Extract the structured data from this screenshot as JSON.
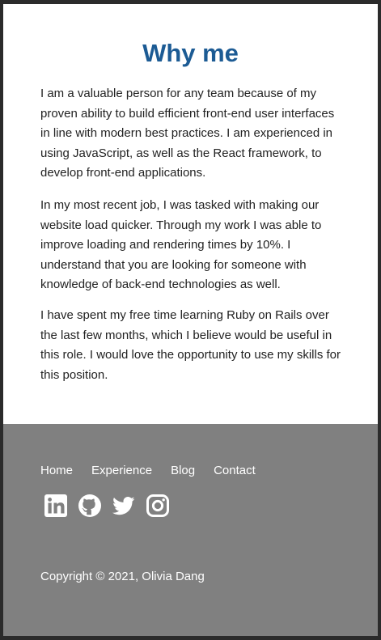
{
  "main": {
    "title": "Why me",
    "paragraphs": [
      "I am a valuable person for any team because of my proven ability to build efficient front-end user interfaces in line with modern best practices. I am experienced in using JavaScript, as well as the React framework, to develop front-end applications.",
      "In my most recent job, I was tasked with making our website load quicker. Through my work I was able to improve loading and rendering times by 10%. I understand that you are looking for someone with knowledge of back-end technologies as well.",
      "I have spent my free time learning Ruby on Rails over the last few months, which I believe would be useful in this role. I would love the opportunity to use my skills for this position."
    ]
  },
  "footer": {
    "nav": [
      "Home",
      "Experience",
      "Blog",
      "Contact"
    ],
    "social_icons": [
      "linkedin-icon",
      "github-icon",
      "twitter-icon",
      "instagram-icon"
    ],
    "copyright": "Copyright © 2021, Olivia Dang"
  },
  "colors": {
    "title": "#1c5b94",
    "footer_bg": "#808080",
    "footer_text": "#ffffff",
    "body_text": "#222222"
  }
}
